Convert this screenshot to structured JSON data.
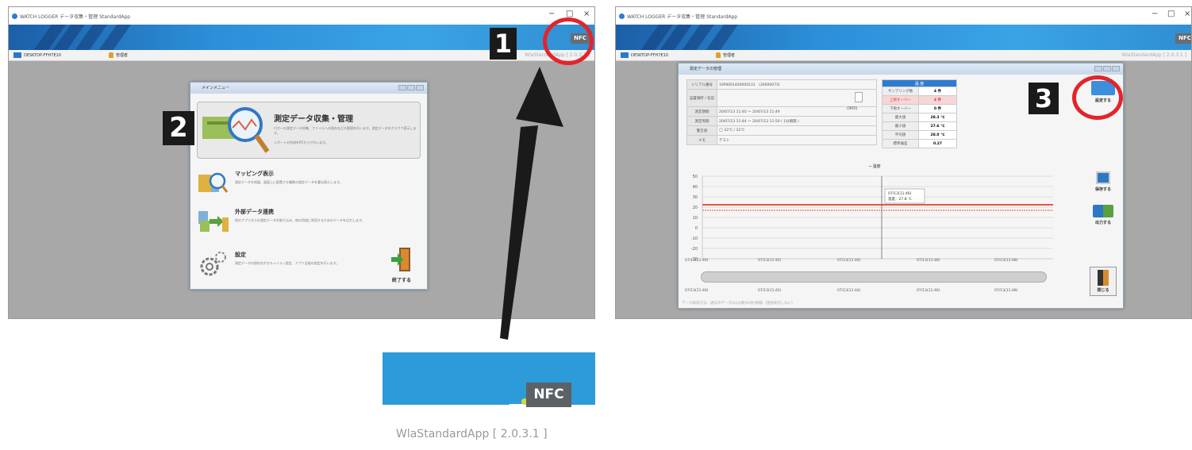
{
  "left_screen": {
    "title_bar": "WATCH LOGGER データ収集・管理 StandardApp",
    "computer_name": "DESKTOP-FFH7E10",
    "user_label": "管理者",
    "version": "WlaStandardApp [ 2.0.3.1 ]",
    "nfc_label": "NFC",
    "menu_dialog": {
      "title": "メインメニュー",
      "items": [
        {
          "heading": "測定データ収集・管理",
          "desc": "ロガーの測定データ収集、ファイルへの保存などの管理を行います。測定データをグラフで表示します。",
          "desc2": "レポートの作成をPCからで行います。"
        },
        {
          "heading": "マッピング表示",
          "desc": "測定データを地図、図面上に配置させ複数の測定データを重ね表示します。"
        },
        {
          "heading": "外部データ連携",
          "desc": "他のアプリからの測定データを取り込み、他の用途に利用するためのデータを出力します。"
        },
        {
          "heading": "設定",
          "desc": "測定データの保存先やセキュリティ設定、アプリ全般の設定を行います。"
        }
      ],
      "exit_label": "終了する"
    }
  },
  "right_screen": {
    "title_bar": "WATCH LOGGER データ収集・管理 StandardApp",
    "computer_name": "DESKTOP-FFH7E10",
    "user_label": "管理者",
    "version": "WlaStandardApp [ 2.0.3.1 ]",
    "nfc_label": "NFC",
    "data_dialog": {
      "title": "測定データの管理",
      "info_rows": [
        {
          "label": "シリアル番号",
          "value": "10P0001400000133　(30000073)"
        },
        {
          "label": "設置場所 / 名前",
          "value": ""
        },
        {
          "label": "測定期間",
          "value": "20/07/13 11:40 ～ 20/07/13 11:49"
        },
        {
          "label": "測定周期",
          "value": "20/07/13 11:44 ～ 20/07/13 11:50 ( 1分間隔 )"
        },
        {
          "label": "警告値",
          "value": "◯ 22℃ / 22℃"
        },
        {
          "label": "メモ",
          "value": "テスト"
        }
      ],
      "count_label": "(900)",
      "stats_header": "温 度",
      "stats": [
        {
          "label": "サンプリング数",
          "value": "4 件"
        },
        {
          "label": "上限オーバー",
          "value": "4 件"
        },
        {
          "label": "下限オーバー",
          "value": "0 件"
        },
        {
          "label": "最大値",
          "value": "28.3 ℃"
        },
        {
          "label": "最小値",
          "value": "27.6 ℃"
        },
        {
          "label": "平均値",
          "value": "28.0 ℃"
        },
        {
          "label": "標準偏差",
          "value": "0.27"
        }
      ],
      "chart_legend": "温度",
      "tooltip_time": "07/13(11:46)",
      "tooltip_value": "温度：27.8 ℃",
      "y_ticks": [
        "50",
        "40",
        "30",
        "20",
        "10",
        "0",
        "-10",
        "-20",
        "-30"
      ],
      "x_ticks": [
        "07/13(11:40)",
        "07/13(11:42)",
        "07/13(11:44)",
        "07/13(11:46)",
        "07/13(11:48)"
      ],
      "range_ticks": [
        "07/13(11:40)",
        "07/13(11:42)",
        "07/13(11:44)",
        "07/13(11:46)",
        "07/13(11:48)"
      ],
      "status_text": "データ取得方法：通信のデータは1分間(60秒)間隔（連続表示しない）",
      "report_label": "設定する",
      "save_label": "保存する",
      "print_label": "出力する",
      "close_label": "閉じる"
    }
  },
  "annotations": {
    "badge_1": "1",
    "badge_2": "2",
    "badge_3": "3"
  },
  "zoom_inset": {
    "nfc_label": "NFC",
    "version": "WlaStandardApp [ 2.0.3.1 ]"
  },
  "colors": {
    "banner": "#2c8fd8",
    "ring": "#e3242b",
    "badge": "#1a1a1a",
    "chart_line": "#e05a40"
  }
}
